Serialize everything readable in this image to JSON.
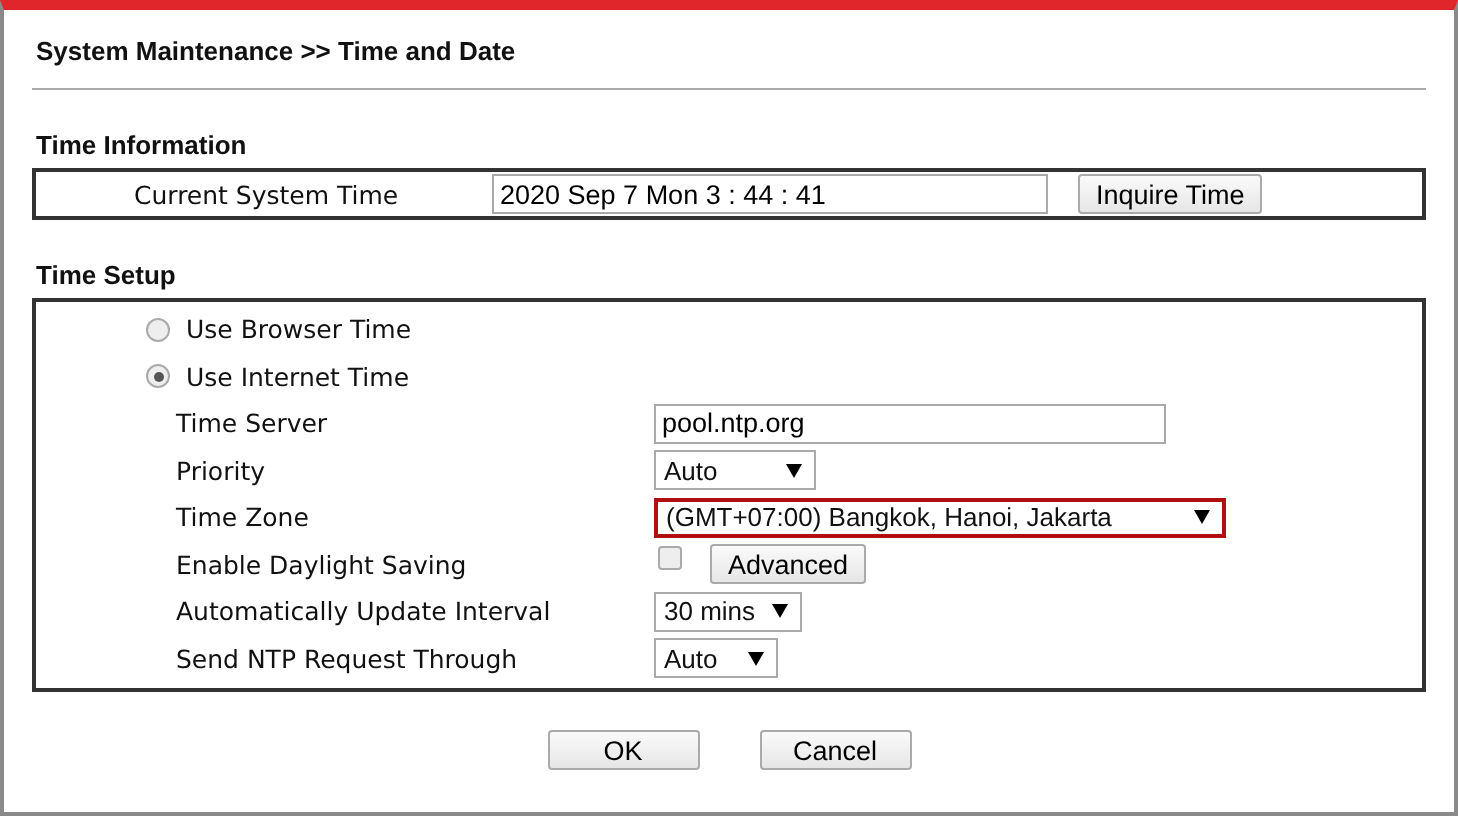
{
  "title": "System Maintenance >> Time and Date",
  "time_information": {
    "heading": "Time Information",
    "label": "Current System Time",
    "value": "2020 Sep 7 Mon 3 : 44 : 41",
    "button": "Inquire Time"
  },
  "time_setup": {
    "heading": "Time Setup",
    "sources": [
      {
        "label": "Use Browser Time",
        "selected": false
      },
      {
        "label": "Use Internet Time",
        "selected": true
      }
    ],
    "fields": [
      {
        "kind": "text",
        "label": "Time Server",
        "value": "pool.ntp.org"
      },
      {
        "kind": "select",
        "label": "Priority",
        "value": "Auto",
        "highlighted": false
      },
      {
        "kind": "select",
        "label": "Time Zone",
        "value": "(GMT+07:00) Bangkok, Hanoi, Jakarta",
        "highlighted": true
      },
      {
        "kind": "checkbox",
        "label": "Enable Daylight Saving",
        "checked": false,
        "button": "Advanced"
      },
      {
        "kind": "select",
        "label": "Automatically Update Interval",
        "value": "30 mins",
        "highlighted": false
      },
      {
        "kind": "select",
        "label": "Send NTP Request Through",
        "value": "Auto",
        "highlighted": false
      }
    ]
  },
  "buttons": [
    "OK",
    "Cancel"
  ]
}
